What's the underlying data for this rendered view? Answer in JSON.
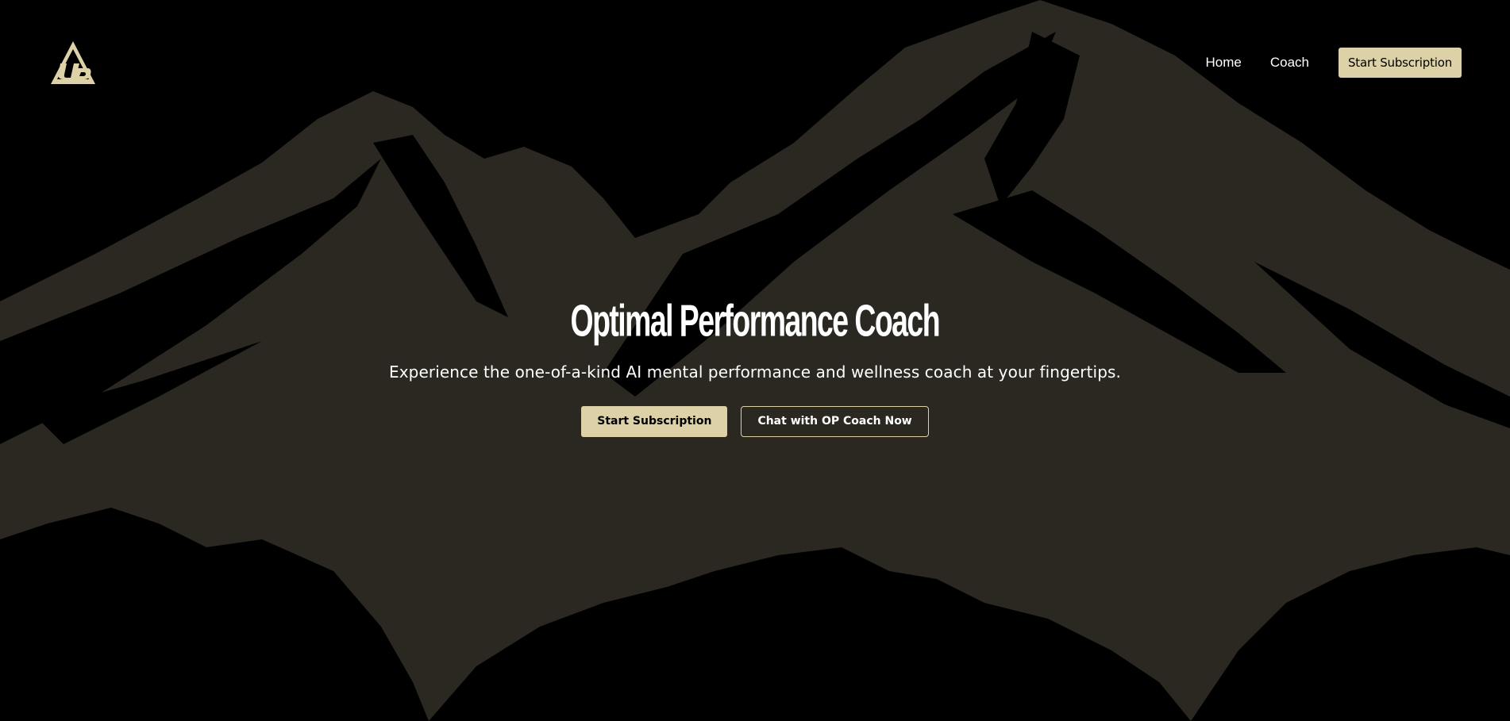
{
  "colors": {
    "background": "#000000",
    "mountain": "#2a2821",
    "accent": "#ddd2a7",
    "text": "#ffffff"
  },
  "header": {
    "logo_icon": "op-mountain-logo",
    "nav": {
      "home_label": "Home",
      "coach_label": "Coach",
      "cta_label": "Start Subscription"
    }
  },
  "hero": {
    "title": "Optimal Performance Coach",
    "subtitle": "Experience the one-of-a-kind AI mental performance and wellness coach at your fingertips.",
    "primary_cta": "Start Subscription",
    "secondary_cta": "Chat with OP Coach Now"
  }
}
